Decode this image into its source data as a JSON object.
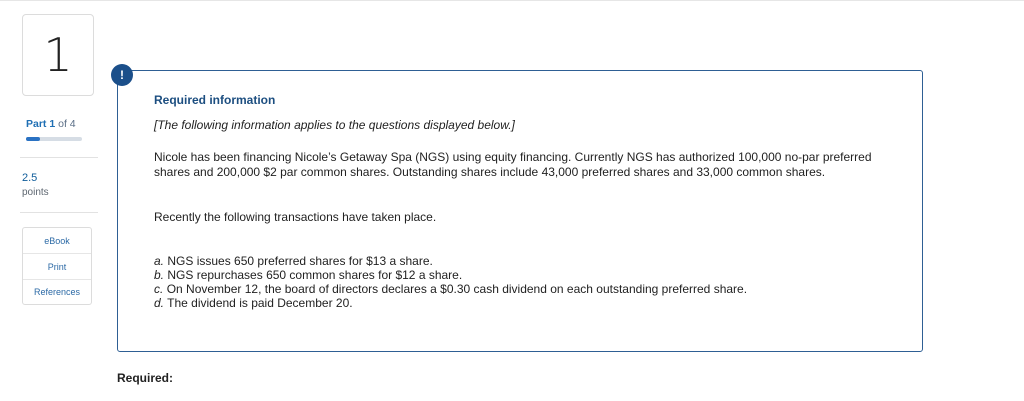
{
  "question_number": "1",
  "part": {
    "prefix": "Part",
    "current": "1",
    "of_label": "of 4",
    "progress_fraction": 0.25
  },
  "points": {
    "value": "2.5",
    "label": "points"
  },
  "side_buttons": [
    "eBook",
    "Print",
    "References"
  ],
  "alert_icon": "!",
  "info": {
    "heading": "Required information",
    "intro": "[The following information applies to the questions displayed below.]",
    "paragraph1": "Nicole has been financing Nicole’s Getaway Spa (NGS) using equity financing. Currently NGS has authorized 100,000 no-par preferred shares and 200,000 $2 par common shares. Outstanding shares include 43,000 preferred shares and 33,000 common shares.",
    "paragraph2": "Recently the following transactions have taken place.",
    "transactions": [
      {
        "letter": "a.",
        "text": "NGS issues 650 preferred shares for $13 a share."
      },
      {
        "letter": "b.",
        "text": "NGS repurchases 650 common shares for $12 a share."
      },
      {
        "letter": "c.",
        "text": "On November 12, the board of directors declares a $0.30 cash dividend on each outstanding preferred share."
      },
      {
        "letter": "d.",
        "text": "The dividend is paid December 20."
      }
    ]
  },
  "required_label": "Required:",
  "colors": {
    "accent": "#1f6fb4",
    "alert": "#1b4f8a",
    "border": "#2e5f94"
  },
  "icons": {
    "alert": "exclamation-icon"
  }
}
